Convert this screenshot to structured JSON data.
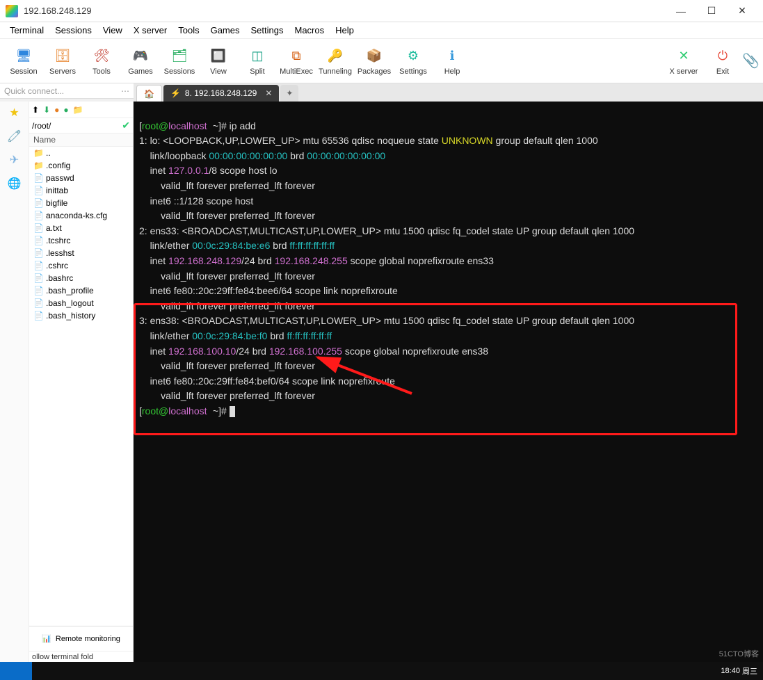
{
  "window": {
    "title": "192.168.248.129"
  },
  "menubar": [
    "Terminal",
    "Sessions",
    "View",
    "X server",
    "Tools",
    "Games",
    "Settings",
    "Macros",
    "Help"
  ],
  "toolbar": [
    {
      "label": "Session",
      "icon": "🖥",
      "cls": "ico-session"
    },
    {
      "label": "Servers",
      "icon": "🗄",
      "cls": "ico-servers"
    },
    {
      "label": "Tools",
      "icon": "🛠",
      "cls": "ico-tools"
    },
    {
      "label": "Games",
      "icon": "🎮",
      "cls": "ico-games"
    },
    {
      "label": "Sessions",
      "icon": "🗂",
      "cls": "ico-sessions"
    },
    {
      "label": "View",
      "icon": "🔲",
      "cls": "ico-view"
    },
    {
      "label": "Split",
      "icon": "◫",
      "cls": "ico-split"
    },
    {
      "label": "MultiExec",
      "icon": "⧉",
      "cls": "ico-multi"
    },
    {
      "label": "Tunneling",
      "icon": "🔑",
      "cls": "ico-tunnel"
    },
    {
      "label": "Packages",
      "icon": "📦",
      "cls": "ico-pkg"
    },
    {
      "label": "Settings",
      "icon": "⚙",
      "cls": "ico-settings"
    },
    {
      "label": "Help",
      "icon": "ℹ",
      "cls": "ico-help"
    }
  ],
  "toolbar_right": [
    {
      "label": "X server",
      "icon": "✕",
      "cls": "ico-xsrv"
    },
    {
      "label": "Exit",
      "icon": "⏻",
      "cls": "ico-exit"
    }
  ],
  "quick_connect_placeholder": "Quick connect...",
  "sidebar": {
    "path": "/root/",
    "header": "Name",
    "files": [
      {
        "name": "..",
        "icon": "📁"
      },
      {
        "name": ".config",
        "icon": "📁"
      },
      {
        "name": "passwd",
        "icon": "📄"
      },
      {
        "name": "inittab",
        "icon": "📄"
      },
      {
        "name": "bigfile",
        "icon": "📄"
      },
      {
        "name": "anaconda-ks.cfg",
        "icon": "📄"
      },
      {
        "name": "a.txt",
        "icon": "📄"
      },
      {
        "name": ".tcshrc",
        "icon": "📄"
      },
      {
        "name": ".lesshst",
        "icon": "📄"
      },
      {
        "name": ".cshrc",
        "icon": "📄"
      },
      {
        "name": ".bashrc",
        "icon": "📄"
      },
      {
        "name": ".bash_profile",
        "icon": "📄"
      },
      {
        "name": ".bash_logout",
        "icon": "📄"
      },
      {
        "name": ".bash_history",
        "icon": "📄"
      }
    ],
    "remote_monitoring": "Remote monitoring",
    "bottom_note": "ollow terminal fold"
  },
  "tabs": {
    "active_label": "8. 192.168.248.129"
  },
  "terminal": {
    "prompt_user": "root",
    "prompt_at": "@",
    "prompt_host": "localhost",
    "prompt_cwd": "~",
    "prompt_suffix": "]# ",
    "cmd": "ip add",
    "if1": {
      "hdr": "1: lo: <LOOPBACK,UP,LOWER_UP> mtu 65536 qdisc noqueue state ",
      "state": "UNKNOWN",
      "hdr_tail": " group default qlen 1000",
      "link_a": "    link/loopback ",
      "mac1": "00:00:00:00:00:00",
      "brd_lbl": " brd ",
      "mac2": "00:00:00:00:00:00",
      "l3": "    inet ",
      "ip": "127.0.0.1",
      "l3b": "/8 scope host lo",
      "l4": "        valid_lft forever preferred_lft forever",
      "l5": "    inet6 ::1/128 scope host",
      "l6": "        valid_lft forever preferred_lft forever"
    },
    "if2": {
      "hdr": "2: ens33: <BROADCAST,MULTICAST,UP,LOWER_UP> mtu 1500 qdisc fq_codel state UP group default qlen 1000",
      "link_a": "    link/ether ",
      "mac1": "00:0c:29:84:be:e6",
      "brd_lbl": " brd ",
      "mac2": "ff:ff:ff:ff:ff:ff",
      "l3": "    inet ",
      "ip": "192.168.248.129",
      "l3m": "/24 brd ",
      "brd": "192.168.248.255",
      "l3b": " scope global noprefixroute ens33",
      "l4": "        valid_lft forever preferred_lft forever",
      "l5": "    inet6 fe80::20c:29ff:fe84:bee6/64 scope link noprefixroute",
      "l6": "        valid_lft forever preferred_lft forever"
    },
    "if3": {
      "hdr": "3: ens38: <BROADCAST,MULTICAST,UP,LOWER_UP> mtu 1500 qdisc fq_codel state UP group default qlen 1000",
      "link_a": "    link/ether ",
      "mac1": "00:0c:29:84:be:f0",
      "brd_lbl": " brd ",
      "mac2": "ff:ff:ff:ff:ff:ff",
      "l3": "    inet ",
      "ip": "192.168.100.10",
      "l3m": "/24 brd ",
      "brd": "192.168.100.255",
      "l3b": " scope global noprefixroute ens38",
      "l4": "        valid_lft forever preferred_lft forever",
      "l5": "    inet6 fe80::20c:29ff:fe84:bef0/64 scope link noprefixroute",
      "l6": "        valid_lft forever preferred_lft forever"
    }
  },
  "taskbar": {
    "time": "18:40",
    "day": "周三"
  },
  "watermark": "51CTO博客"
}
